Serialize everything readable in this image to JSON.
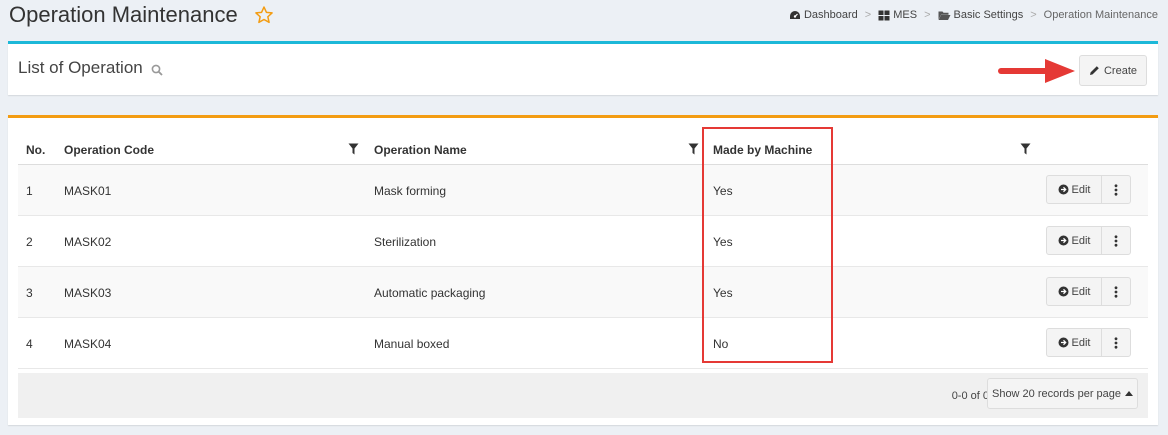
{
  "page": {
    "title": "Operation Maintenance",
    "favorite_icon": "star-outline-icon",
    "accent_star": "#f39c12"
  },
  "breadcrumb": [
    {
      "label": "Dashboard",
      "icon": "dashboard-icon"
    },
    {
      "label": "MES",
      "icon": "grid-icon"
    },
    {
      "label": "Basic Settings",
      "icon": "folder-open-icon"
    },
    {
      "label": "Operation Maintenance",
      "icon": ""
    }
  ],
  "list_box": {
    "title": "List of Operation",
    "search_icon": "search-icon",
    "create_label": "Create",
    "create_icon": "pencil-icon",
    "accent": "#1cb8d8"
  },
  "table": {
    "accent": "#f39c12",
    "columns": [
      "No.",
      "Operation Code",
      "Operation Name",
      "Made by Machine"
    ],
    "rows": [
      {
        "no": "1",
        "code": "MASK01",
        "name": "Mask forming",
        "machine": "Yes"
      },
      {
        "no": "2",
        "code": "MASK02",
        "name": "Sterilization",
        "machine": "Yes"
      },
      {
        "no": "3",
        "code": "MASK03",
        "name": "Automatic packaging",
        "machine": "Yes"
      },
      {
        "no": "4",
        "code": "MASK04",
        "name": "Manual boxed",
        "machine": "No"
      }
    ],
    "edit_label": "Edit",
    "record_count": "0-0 of 0",
    "per_page_label": "Show 20 records per page"
  },
  "annotation": {
    "highlight_color": "#e53935"
  }
}
